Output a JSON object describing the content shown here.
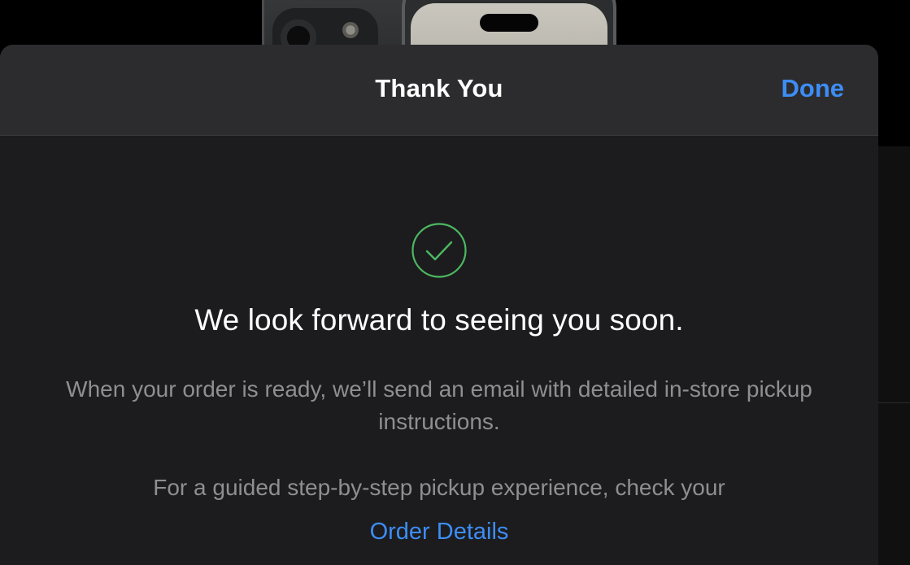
{
  "header": {
    "title": "Thank You",
    "done_label": "Done"
  },
  "confirmation": {
    "icon": "checkmark-circle-icon",
    "headline": "We look forward to seeing you soon.",
    "message": "When your order is ready, we’ll send an email with detailed in-store pickup instructions.",
    "guided_text": "For a guided step-by-step pickup experience, check your",
    "order_details_link": "Order Details"
  },
  "colors": {
    "accent": "#3d8df5",
    "success": "#4cb861",
    "sheet_background": "#1c1c1e",
    "header_background": "#2c2c2e",
    "secondary_text": "#8e8e93"
  }
}
